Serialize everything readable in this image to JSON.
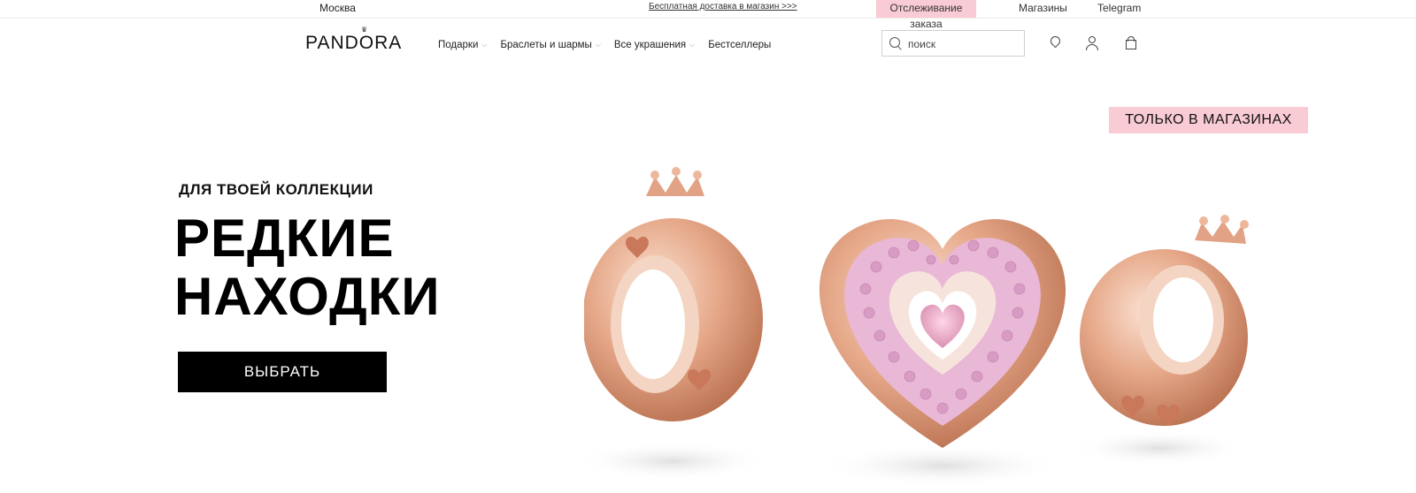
{
  "topbar": {
    "city": "Москва",
    "promo": "Бесплатная доставка в магазин >>>",
    "track_order": "Отслеживание заказа",
    "stores": "Магазины",
    "telegram": "Telegram"
  },
  "header": {
    "logo": "PANDORA",
    "nav": [
      {
        "label": "Подарки",
        "has_dropdown": true
      },
      {
        "label": "Браслеты и шармы",
        "has_dropdown": true
      },
      {
        "label": "Все украшения",
        "has_dropdown": true
      },
      {
        "label": "Бестселлеры",
        "has_dropdown": false
      }
    ],
    "search_placeholder": "поиск"
  },
  "hero": {
    "badge": "ТОЛЬКО В МАГАЗИНАХ",
    "eyebrow": "ДЛЯ ТВОЕЙ КОЛЛЕКЦИИ",
    "headline_line1": "РЕДКИЕ",
    "headline_line2": "НАХОДКИ",
    "cta": "ВЫБРАТЬ"
  },
  "colors": {
    "accent_pink": "#f9cbd4",
    "rose_gold": "#e0a184",
    "stone_pink": "#e9b3d3"
  }
}
